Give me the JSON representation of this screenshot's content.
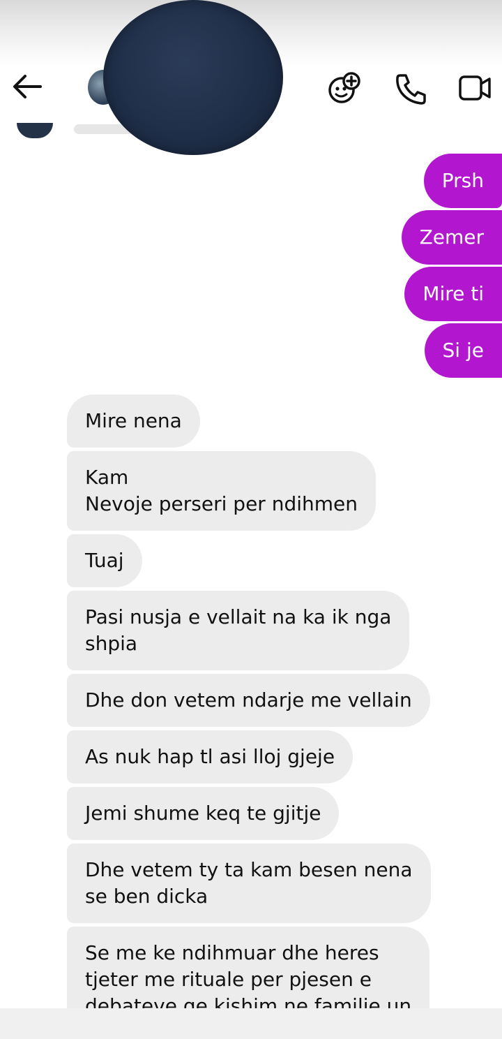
{
  "header": {
    "icons": [
      "back-arrow-icon",
      "effects-icon",
      "phone-icon",
      "video-icon"
    ]
  },
  "colors": {
    "outgoing_bubble": "#b217cf",
    "incoming_bubble": "#ececec"
  },
  "messages": {
    "outgoing": [
      "Prsh",
      "Zemer",
      "Mire ti",
      "Si je"
    ],
    "incoming": [
      [
        "Mire nena"
      ],
      [
        "Kam",
        "Nevoje perseri per ndihmen"
      ],
      [
        "Tuaj"
      ],
      [
        "Pasi nusja e vellait na ka ik nga",
        "shpia"
      ],
      [
        "Dhe don vetem ndarje me vellain"
      ],
      [
        "As nuk hap tl asi lloj gjeje"
      ],
      [
        "Jemi shume keq te gjitje"
      ],
      [
        "Dhe vetem ty ta kam besen nena",
        "se ben dicka"
      ],
      [
        "Se me ke ndihmuar dhe heres",
        "tjeter me rituale per pjesen e",
        "debateve qe kishim ne familje un"
      ]
    ]
  }
}
